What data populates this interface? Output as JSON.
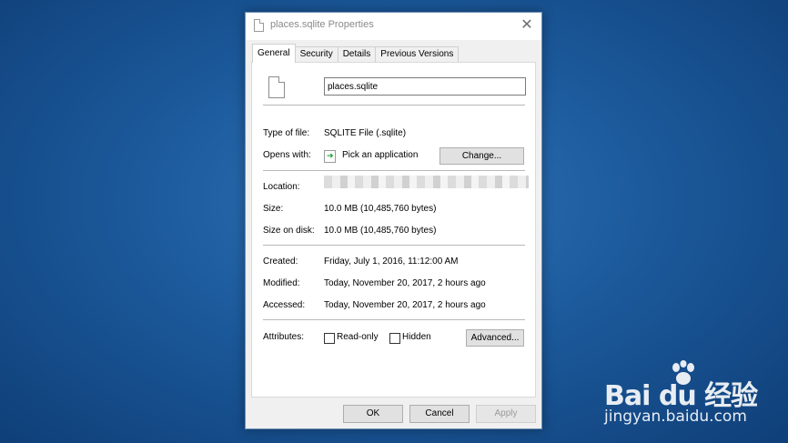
{
  "window": {
    "title": "places.sqlite Properties",
    "close_glyph": "✕"
  },
  "tabs": [
    {
      "label": "General",
      "active": true
    },
    {
      "label": "Security",
      "active": false
    },
    {
      "label": "Details",
      "active": false
    },
    {
      "label": "Previous Versions",
      "active": false
    }
  ],
  "general": {
    "file_name": "places.sqlite",
    "type_label": "Type of file:",
    "type_value": "SQLITE File (.sqlite)",
    "opens_label": "Opens with:",
    "opens_value": "Pick an application",
    "change_button": "Change...",
    "location_label": "Location:",
    "size_label": "Size:",
    "size_value": "10.0 MB (10,485,760 bytes)",
    "size_disk_label": "Size on disk:",
    "size_disk_value": "10.0 MB (10,485,760 bytes)",
    "created_label": "Created:",
    "created_value": "Friday, July 1, 2016, 11:12:00 AM",
    "modified_label": "Modified:",
    "modified_value": "Today, November 20, 2017, 2 hours ago",
    "accessed_label": "Accessed:",
    "accessed_value": "Today, November 20, 2017, 2 hours ago",
    "attributes_label": "Attributes:",
    "readonly_label": "Read-only",
    "readonly_checked": false,
    "hidden_label": "Hidden",
    "hidden_checked": false,
    "advanced_button": "Advanced..."
  },
  "footer": {
    "ok": "OK",
    "cancel": "Cancel",
    "apply": "Apply",
    "apply_enabled": false
  },
  "watermark": {
    "brand": "Bai du 经验",
    "url": "jingyan.baidu.com"
  },
  "icons": {
    "title": "document-icon",
    "file": "document-icon",
    "app": "green-arrow-app-icon"
  }
}
